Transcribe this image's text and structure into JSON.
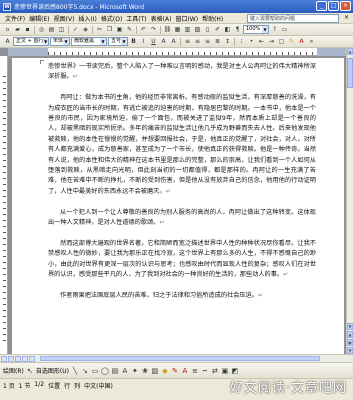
{
  "window": {
    "title": "悲惨世界读后感800字5.docx - Microsoft Word"
  },
  "menubar": {
    "items": [
      "文件(F)",
      "编辑(E)",
      "视图(V)",
      "插入(I)",
      "格式(O)",
      "工具(T)",
      "表格(A)",
      "窗口(W)",
      "帮助(H)"
    ],
    "help_placeholder": "键入需要帮助的问题"
  },
  "toolbar": {
    "style_value": "正文 + 首行",
    "font_value": "宋体",
    "size_value": "五号",
    "style_combo2": "微软雅黑"
  },
  "document": {
    "paragraphs": [
      "悲惨世界》一书读完后，整个人陷入了一种难以言明的感动，我是对主人公冉阿让的伟大精神所深深折服。",
      "冉阿让：做为本书的主角，他的经历非常离析。有感动般的监狱生活，有深厚慈善的洗澡，有为成衣匠的当市长的时期，有逃亡被追的迫害的时期，有隐居巴黎的时期。一本书中，他本是一个善良的市民，因为家境所迫，偷了一个面包，而被关进了监狱9年，然而本质上却是一个善良的人，却被黑暗的现实所扼杀。多年的痛苦的监狱生活让他几乎成为野兽而失去人性。后来他发现他被救赎，他的本性在慢慢的觉醒，并想要回报社会，于是，他真正的觉醒了，对社会，对人，对所有人都充满爱心，成为慈善家，甚至成为了一个市长，使他真正的获得救赎。他是一种传奇。当然有人说，他的本性和伟大的精神在这本书里是那么的完整，那么的崇高，让我们看到一个人如何从堕落到救赎，从黑暗走向光明，但此刻当初的一切都值得，都是那样的。冉阿让的一生充满了苦难，他在苦难中不断的挣扎，不断的受到伤害，但是他从没有放弃自己的信念，他用他的行动证明了，人性中最美好的东西永远不会被磨灭。",
      "从一个犯人到一个让人尊敬的善良的为别人服务的高尚的人，冉阿让做出了这种转变。这体现出一种人文精神，是对人性道德的歌颂。",
      "然而这部博大遍观的世界名著，它和简陋而宽泛描述世界中人性的种种状况尽你看尽。让我不禁感叹人性的微妙，要让我为那乐正在找冷寂，这个世界上有那么多的人生，不得不感慨自己的渺小，由此的对世界有更深一层次的认识与思考；也感叹由时代而显现人性的复杂；感叹人们在对世界的认识，感受那些平凡的人，为了我到对社会的一种良好的生活的，那些动人的事。",
      "作者雨果把法国底层人民的苦难，归之于法律和习俗所造成的社会压迫。"
    ]
  },
  "drawbar": {
    "draw_label": "绘图(R)",
    "autoshape_label": "自选图形(U)"
  },
  "statusbar": {
    "page": "1 页",
    "section": "1 节",
    "page_of": "1/2",
    "position": "位置",
    "line": "行",
    "col": "列",
    "lang": "中文(中国)"
  },
  "watermark": "好文阅读·文章吧网"
}
